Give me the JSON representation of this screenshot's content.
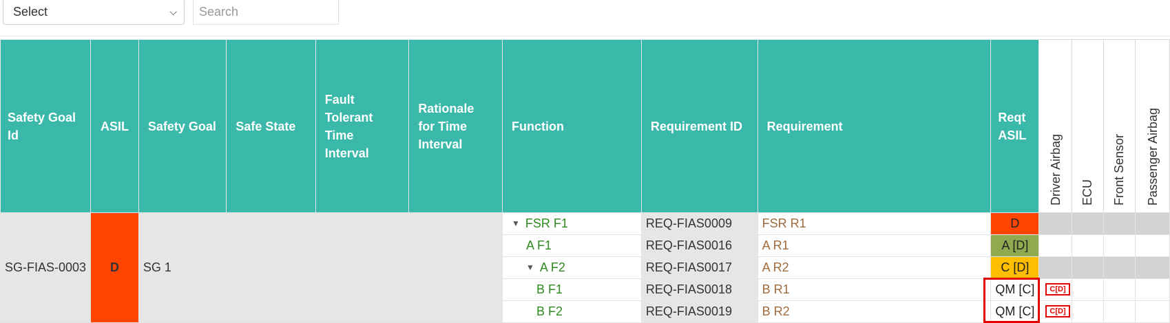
{
  "toolbar": {
    "select_value": "Select",
    "search_placeholder": "Search"
  },
  "columns": {
    "safety_goal_id": "Safety Goal Id",
    "asil": "ASIL",
    "safety_goal": "Safety Goal",
    "safe_state": "Safe State",
    "ftti": "Fault Tolerant Time Interval",
    "rationale": "Rationale for Time Interval",
    "function": "Function",
    "requirement_id": "Requirement ID",
    "requirement": "Requirement",
    "reqt_asil": "Reqt ASIL",
    "components": [
      "Driver Airbag",
      "ECU",
      "Front Sensor",
      "Passenger Airbag"
    ]
  },
  "goal": {
    "id": "SG-FIAS-0003",
    "asil": "D",
    "name": "SG 1",
    "safe_state": "",
    "ftti": "",
    "rationale": ""
  },
  "rows": [
    {
      "function": "FSR F1",
      "requirement_id": "REQ-FIAS0009",
      "requirement": "FSR R1",
      "reqt_asil": "D",
      "tag": ""
    },
    {
      "function": "A F1",
      "requirement_id": "REQ-FIAS0016",
      "requirement": "A R1",
      "reqt_asil": "A [D]",
      "tag": ""
    },
    {
      "function": "A F2",
      "requirement_id": "REQ-FIAS0017",
      "requirement": "A R2",
      "reqt_asil": "C [D]",
      "tag": ""
    },
    {
      "function": "B F1",
      "requirement_id": "REQ-FIAS0018",
      "requirement": "B R1",
      "reqt_asil": "QM [C]",
      "tag": "C[D]"
    },
    {
      "function": "B F2",
      "requirement_id": "REQ-FIAS0019",
      "requirement": "B R2",
      "reqt_asil": "QM [C]",
      "tag": "C[D]"
    }
  ],
  "colors": {
    "header": "#3ab8aa",
    "asil_D": "#ff4500",
    "asil_A": "#8faa4f",
    "asil_C": "#ffbf00",
    "function_text": "#2e8b1e",
    "requirement_text": "#a06a3b",
    "highlight": "#e00000"
  }
}
